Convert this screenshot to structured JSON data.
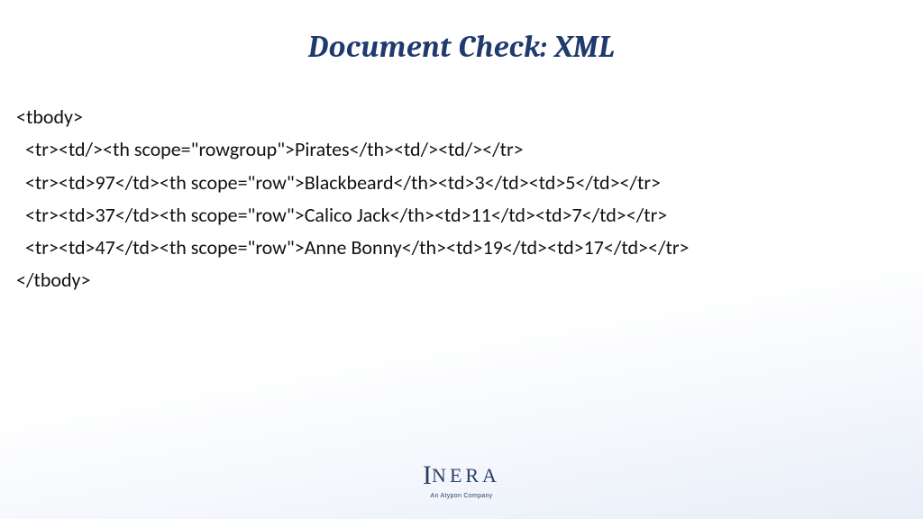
{
  "title": "Document Check: XML",
  "code": {
    "l0": "<tbody>",
    "l1": "  <tr><td/><th scope=\"rowgroup\">Pirates</th><td/><td/></tr>",
    "l2": "  <tr><td>97</td><th scope=\"row\">Blackbeard</th><td>3</td><td>5</td></tr>",
    "l3": "  <tr><td>37</td><th scope=\"row\">Calico Jack</th><td>11</td><td>7</td></tr>",
    "l4": "  <tr><td>47</td><th scope=\"row\">Anne Bonny</th><td>19</td><td>17</td></tr>",
    "l5": "</tbody>"
  },
  "logo": {
    "main_rest": "NERA",
    "sub": "An Atypon Company"
  }
}
